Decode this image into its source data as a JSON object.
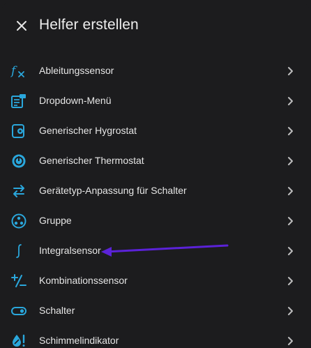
{
  "colors": {
    "background": "#1c1c1e",
    "accent": "#2aa7dc",
    "text": "#e6e6e6",
    "chevron": "#bdbdbd",
    "annotation_arrow": "#5b22d8"
  },
  "header": {
    "title": "Helfer erstellen",
    "close_icon": "close-icon"
  },
  "items": [
    {
      "label": "Ableitungssensor",
      "icon": "derivative-fx-icon"
    },
    {
      "label": "Dropdown-Menü",
      "icon": "form-dropdown-icon"
    },
    {
      "label": "Generischer Hygrostat",
      "icon": "hygrostat-icon"
    },
    {
      "label": "Generischer Thermostat",
      "icon": "thermostat-icon"
    },
    {
      "label": "Gerätetyp-Anpassung für Schalter",
      "icon": "swap-arrows-icon"
    },
    {
      "label": "Gruppe",
      "icon": "group-circle-icon"
    },
    {
      "label": "Integralsensor",
      "icon": "integral-icon"
    },
    {
      "label": "Kombinationssensor",
      "icon": "plus-minus-icon"
    },
    {
      "label": "Schalter",
      "icon": "toggle-switch-icon"
    },
    {
      "label": "Schimmelindikator",
      "icon": "mold-drop-icon"
    }
  ]
}
